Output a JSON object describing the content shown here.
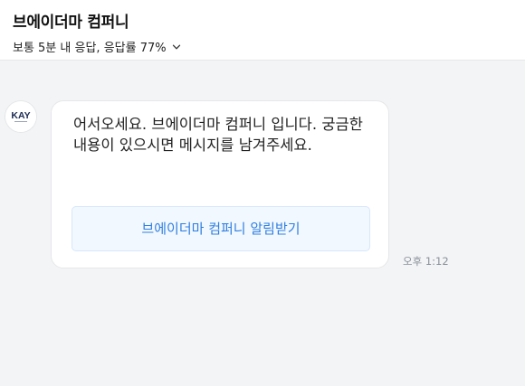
{
  "header": {
    "title": "브에이더마 컴퍼니",
    "response_status": "보통 5분 내 응답, 응답률 77%"
  },
  "chat": {
    "avatar_logo_text": "KAY",
    "message_text": "어서오세요. 브에이더마 컴퍼니 입니다. 궁금한 내용이 있으시면 메시지를 남겨주세요.",
    "subscribe_button_label": "브에이더마 컴퍼니 알림받기",
    "timestamp": "오후 1:12"
  },
  "colors": {
    "accent": "#2f7fe0",
    "button_bg": "#f2f8ff",
    "background": "#f3f4f6",
    "logo": "#1d2a52"
  },
  "icons": {
    "status_toggle": "chevron-down-icon",
    "avatar": "kay-logo-icon"
  }
}
